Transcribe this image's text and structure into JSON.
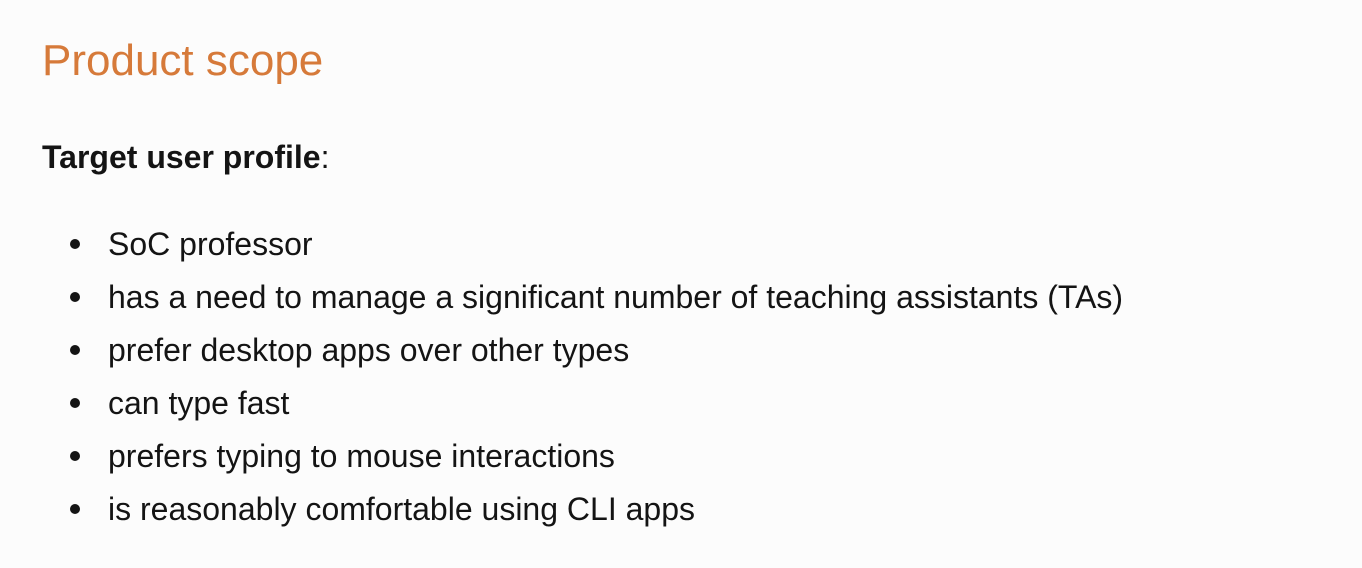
{
  "section": {
    "title": "Product scope"
  },
  "target_user": {
    "heading": "Target user profile",
    "heading_suffix": ":",
    "items": [
      "SoC professor",
      "has a need to manage a significant number of teaching assistants (TAs)",
      "prefer desktop apps over other types",
      "can type fast",
      "prefers typing to mouse interactions",
      "is reasonably comfortable using CLI apps"
    ]
  },
  "colors": {
    "heading_accent": "#d67a3a",
    "text": "#141414",
    "background": "#fcfcfc"
  }
}
